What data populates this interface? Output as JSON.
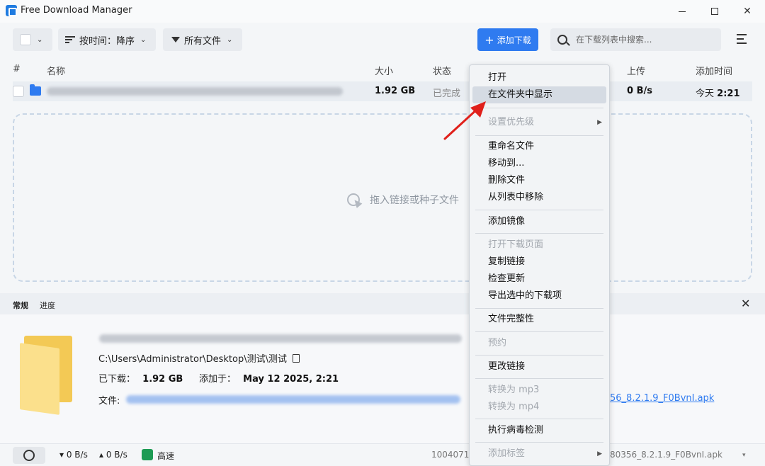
{
  "window": {
    "title": "Free Download Manager"
  },
  "toolbar": {
    "sort_label": "按时间：降序",
    "filter_label": "所有文件",
    "add_label": "添加下载",
    "search_placeholder": "在下载列表中搜索..."
  },
  "columns": {
    "index": "#",
    "name": "名称",
    "size": "大小",
    "status": "状态",
    "upload": "上传",
    "added": "添加时间"
  },
  "row": {
    "size": "1.92 GB",
    "status": "已完成",
    "upload": "0 B/s",
    "added_prefix": "今天",
    "added_time": "2:21"
  },
  "dropzone": {
    "hint": "拖入链接或种子文件"
  },
  "details": {
    "tabs": [
      "常规",
      "进度"
    ],
    "path": "C:\\Users\\Administrator\\Desktop\\测试\\测试",
    "downloaded_label": "已下载：",
    "downloaded_value": "1.92 GB",
    "added_label": "添加于：",
    "added_value": "May 12 2025, 2:21",
    "file_label": "文件:",
    "file_link_tail": "56_8.2.1.9_F0BvnI.apk"
  },
  "statusbar": {
    "down_speed": "▾ 0 B/s",
    "up_speed": "▴ 0 B/s",
    "mode": "高速",
    "id_partial": "1004071",
    "file_partial": "80356_8.2.1.9_F0BvnI.apk"
  },
  "context_menu": {
    "open": "打开",
    "show_in_folder": "在文件夹中显示",
    "set_priority": "设置优先级",
    "rename": "重命名文件",
    "move_to": "移动到...",
    "delete": "删除文件",
    "remove_from_list": "从列表中移除",
    "add_mirror": "添加镜像",
    "open_download_page": "打开下载页面",
    "copy_link": "复制链接",
    "check_update": "检查更新",
    "export_selected": "导出选中的下载项",
    "file_integrity": "文件完整性",
    "schedule": "预约",
    "change_link": "更改链接",
    "convert_mp3": "转换为 mp3",
    "convert_mp4": "转换为 mp4",
    "virus_scan": "执行病毒检测",
    "add_tag": "添加标签"
  },
  "colors": {
    "accent": "#2f7bf0",
    "annotation_arrow": "#e0201b"
  }
}
